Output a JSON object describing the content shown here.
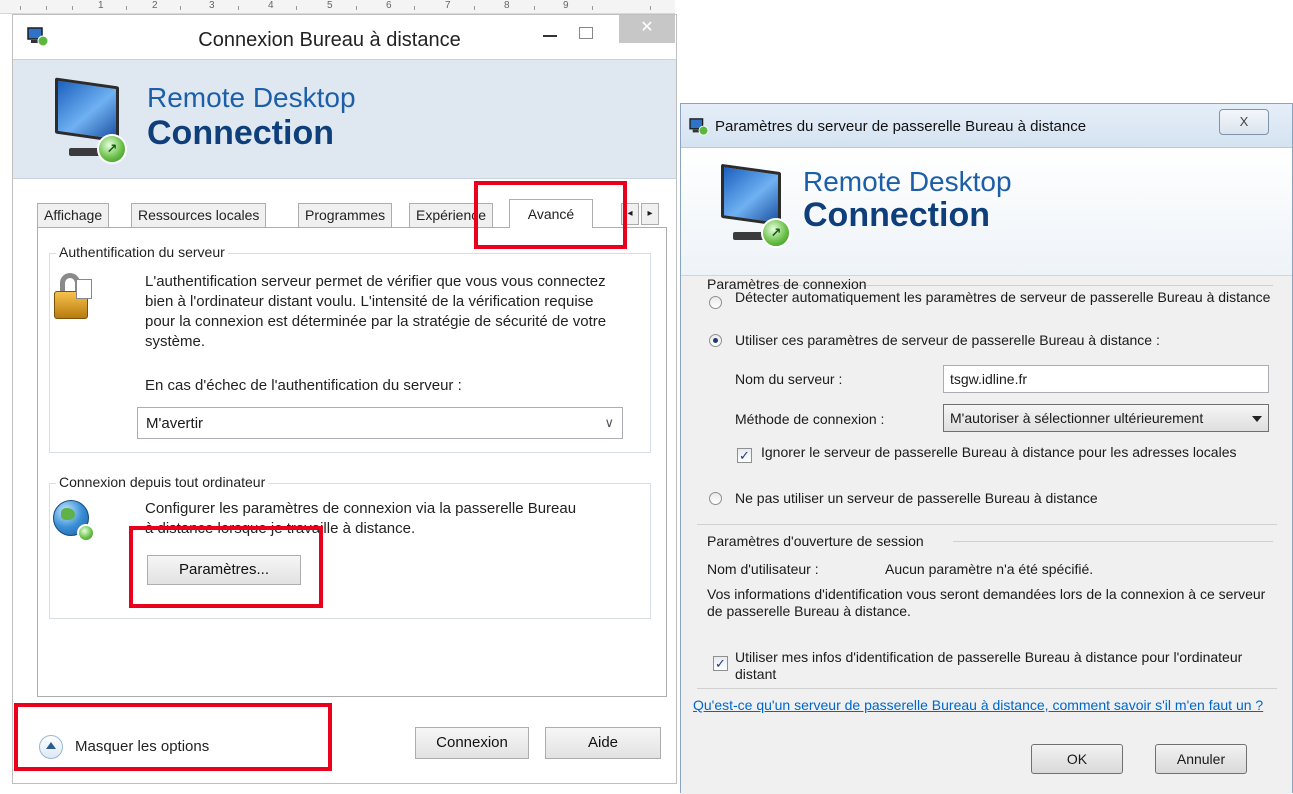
{
  "left_window": {
    "title": "Connexion Bureau à distance",
    "close_glyph": "✕",
    "banner": {
      "line1": "Remote Desktop",
      "line2": "Connection"
    },
    "tabs": [
      {
        "label": "Affichage"
      },
      {
        "label": "Ressources locales"
      },
      {
        "label": "Programmes"
      },
      {
        "label": "Expérience"
      },
      {
        "label": "Avancé"
      }
    ],
    "tab_scroll_left": "◂",
    "tab_scroll_right": "▸",
    "auth_group": {
      "title": "Authentification du serveur",
      "description": "L'authentification serveur permet de vérifier que vous vous connectez bien à l'ordinateur distant voulu. L'intensité de la vérification requise pour la connexion est déterminée par la stratégie de sécurité de votre système.",
      "select_label": "En cas d'échec de l'authentification du serveur :",
      "select_value": "M'avertir",
      "select_chevron": "∨"
    },
    "connect_group": {
      "title": "Connexion depuis tout ordinateur",
      "description": "Configurer les paramètres de connexion via la passerelle Bureau à distance lorsque je travaille à distance.",
      "settings_button": "Paramètres..."
    },
    "hide_options": "Masquer les options",
    "connect_button": "Connexion",
    "help_button": "Aide"
  },
  "right_window": {
    "title": "Paramètres du serveur de passerelle Bureau à distance",
    "close_glyph": "X",
    "banner": {
      "line1": "Remote Desktop",
      "line2": "Connection"
    },
    "connection_settings": {
      "title": "Paramètres de connexion",
      "option_auto": "Détecter automatiquement les paramètres de serveur de passerelle Bureau à distance",
      "option_use": "Utiliser ces paramètres de serveur de passerelle Bureau à distance :",
      "server_name_label": "Nom du serveur :",
      "server_name_value": "tsgw.idline.fr",
      "method_label": "Méthode de connexion :",
      "method_value": "M'autoriser à sélectionner ultérieurement",
      "bypass_local": "Ignorer le serveur de passerelle Bureau à distance pour les adresses locales",
      "option_none": "Ne pas utiliser un serveur de passerelle Bureau à distance"
    },
    "logon_settings": {
      "title": "Paramètres d'ouverture de session",
      "username_label": "Nom d'utilisateur :",
      "username_value": "Aucun paramètre n'a été spécifié.",
      "info": "Vos informations d'identification vous seront demandées lors de la connexion à ce serveur de passerelle Bureau à distance.",
      "use_credentials": "Utiliser mes infos d'identification de passerelle Bureau à distance pour l'ordinateur distant"
    },
    "help_link": "Qu'est-ce qu'un serveur de passerelle Bureau à distance, comment savoir s'il m'en faut un ?",
    "ok_button": "OK",
    "cancel_button": "Annuler",
    "check_glyph": "✓"
  },
  "ruler": {
    "numbers": [
      "1",
      "2",
      "3",
      "4",
      "5",
      "6",
      "7",
      "8",
      "9"
    ]
  },
  "colors": {
    "highlight": "#e8001c",
    "accent": "#1c5fa8",
    "link": "#0066cc"
  }
}
